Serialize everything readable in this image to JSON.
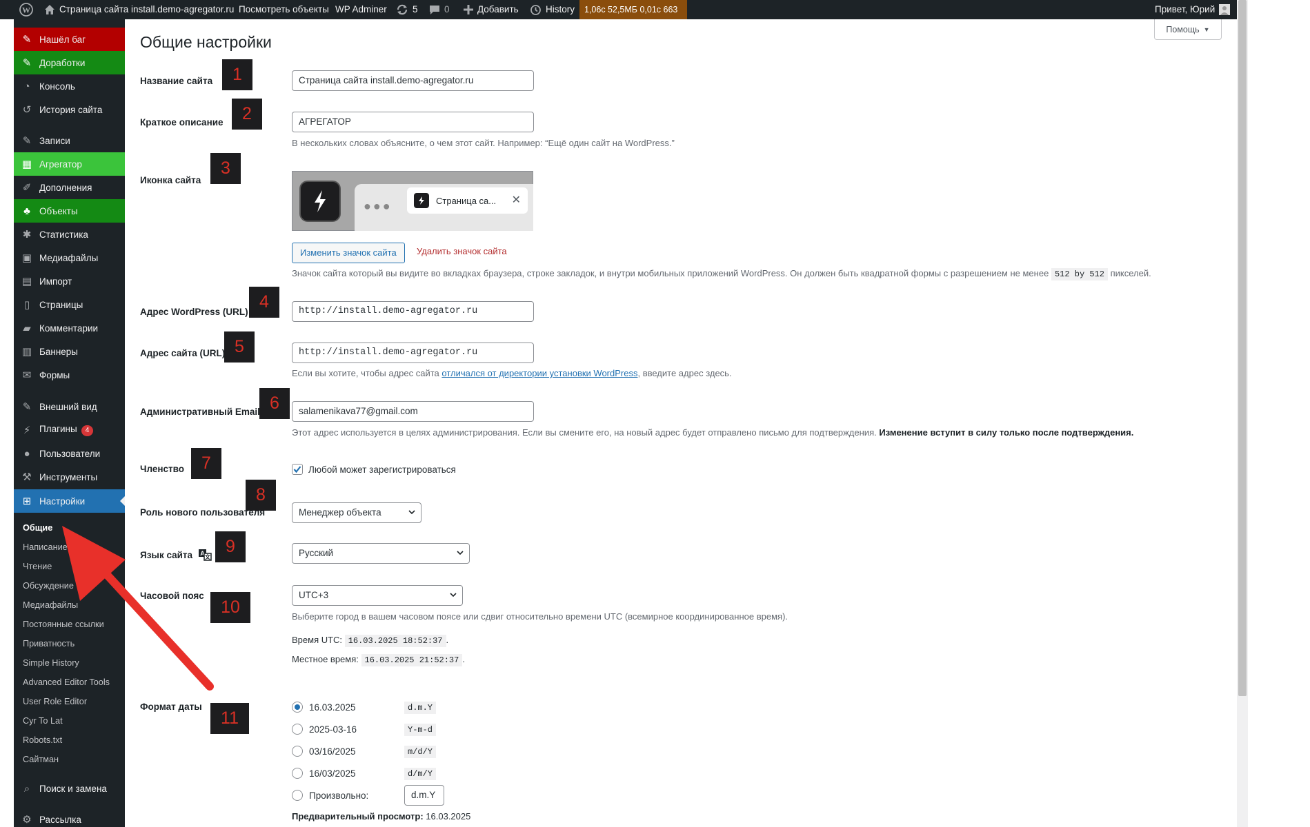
{
  "admin_bar": {
    "site_name": "Страница сайта install.demo-agregator.ru",
    "view_objects": "Посмотреть объекты",
    "wp_adminer": "WP Adminer",
    "updates_count": "5",
    "comments_count": "0",
    "add_new": "Добавить",
    "history": "History",
    "perf": "1,06с  52,5МБ  0,01с  663",
    "greeting": "Привет, Юрий"
  },
  "menu": {
    "items": [
      {
        "label": "Нашёл баг",
        "icon": "pushpin-icon"
      },
      {
        "label": "Доработки",
        "icon": "pushpin-icon"
      },
      {
        "label": "Консоль",
        "icon": "dashboard-icon"
      },
      {
        "label": "История сайта",
        "icon": "history-icon"
      },
      {
        "label": "Записи",
        "icon": "pushpin-icon"
      },
      {
        "label": "Агрегатор",
        "icon": "grid-icon"
      },
      {
        "label": "Дополнения",
        "icon": "brush-icon"
      },
      {
        "label": "Объекты",
        "icon": "palm-icon"
      },
      {
        "label": "Статистика",
        "icon": "chart-icon"
      },
      {
        "label": "Медиафайлы",
        "icon": "media-icon"
      },
      {
        "label": "Импорт",
        "icon": "import-icon"
      },
      {
        "label": "Страницы",
        "icon": "page-icon"
      },
      {
        "label": "Комментарии",
        "icon": "comment-icon"
      },
      {
        "label": "Баннеры",
        "icon": "banner-icon"
      },
      {
        "label": "Формы",
        "icon": "mail-icon"
      },
      {
        "label": "Внешний вид",
        "icon": "appearance-icon"
      },
      {
        "label": "Плагины",
        "icon": "plugin-icon",
        "badge": "4"
      },
      {
        "label": "Пользователи",
        "icon": "users-icon"
      },
      {
        "label": "Инструменты",
        "icon": "wrench-icon"
      },
      {
        "label": "Настройки",
        "icon": "settings-icon"
      },
      {
        "label": "Поиск и замена",
        "icon": "search-icon"
      },
      {
        "label": "Рассылка",
        "icon": "gear-icon"
      }
    ],
    "submenu": [
      "Общие",
      "Написание",
      "Чтение",
      "Обсуждение",
      "Медиафайлы",
      "Постоянные ссылки",
      "Приватность",
      "Simple History",
      "Advanced Editor Tools",
      "User Role Editor",
      "Cyr To Lat",
      "Robots.txt",
      "Сайтман"
    ]
  },
  "help_button": "Помощь",
  "page_title": "Общие настройки",
  "fields": {
    "site_title": {
      "label": "Название сайта",
      "value": "Страница сайта install.demo-agregator.ru"
    },
    "tagline": {
      "label": "Краткое описание",
      "value": "АГРЕГАТОР",
      "description": "В нескольких словах объясните, о чем этот сайт. Например: “Ещё один сайт на WordPress.”"
    },
    "site_icon": {
      "label": "Иконка сайта",
      "tab_title": "Страница са...",
      "change_button": "Изменить значок сайта",
      "remove_link": "Удалить значок сайта",
      "description_before": "Значок сайта который вы видите во вкладках браузера, строке закладок, и внутри мобильных приложений WordPress. Он должен быть квадратной формы с разрешением не менее",
      "size_code": "512 by 512",
      "description_after": "пикселей."
    },
    "wp_url": {
      "label": "Адрес WordPress (URL)",
      "value": "http://install.demo-agregator.ru"
    },
    "site_url": {
      "label": "Адрес сайта (URL)",
      "value": "http://install.demo-agregator.ru",
      "description_before": "Если вы хотите, чтобы адрес сайта",
      "description_link": "отличался от директории установки WordPress",
      "description_after": ", введите адрес здесь."
    },
    "admin_email": {
      "label": "Административный Email",
      "value": "salamenikava77@gmail.com",
      "description": "Этот адрес используется в целях администрирования. Если вы смените его, на новый адрес будет отправлено письмо для подтверждения.",
      "description_bold": "Изменение вступит в силу только после подтверждения."
    },
    "membership": {
      "label": "Членство",
      "checkbox_label": "Любой может зарегистрироваться",
      "checked": true
    },
    "default_role": {
      "label": "Роль нового пользователя",
      "value": "Менеджер объекта"
    },
    "site_language": {
      "label": "Язык сайта",
      "value": "Русский"
    },
    "timezone": {
      "label": "Часовой пояс",
      "value": "UTC+3",
      "description": "Выберите город в вашем часовом поясе или сдвиг относительно времени UTC (всемирное координированное время).",
      "utc_label": "Время UTC:",
      "utc_time": "16.03.2025 18:52:37",
      "local_label": "Местное время:",
      "local_time": "16.03.2025 21:52:37"
    },
    "date_format": {
      "label": "Формат даты",
      "options": [
        {
          "label": "16.03.2025",
          "code": "d.m.Y",
          "selected": true
        },
        {
          "label": "2025-03-16",
          "code": "Y-m-d",
          "selected": false
        },
        {
          "label": "03/16/2025",
          "code": "m/d/Y",
          "selected": false
        },
        {
          "label": "16/03/2025",
          "code": "d/m/Y",
          "selected": false
        }
      ],
      "custom_label": "Произвольно:",
      "custom_value": "d.m.Y",
      "preview_label": "Предварительный просмотр:",
      "preview_value": "16.03.2025"
    }
  },
  "annotations": [
    "1",
    "2",
    "3",
    "4",
    "5",
    "6",
    "7",
    "8",
    "9",
    "10",
    "11"
  ],
  "colors": {
    "menu_bg": "#1d2327",
    "bug_item": "#b30000",
    "dev_item": "#148a14",
    "aggregator_item": "#3bc43b",
    "current_item": "#2271b1",
    "perf_bg": "#8a4d0c",
    "annotation_box": "#1d1d1f",
    "annotation_text": "#d93025",
    "arrow": "#e8302a"
  }
}
